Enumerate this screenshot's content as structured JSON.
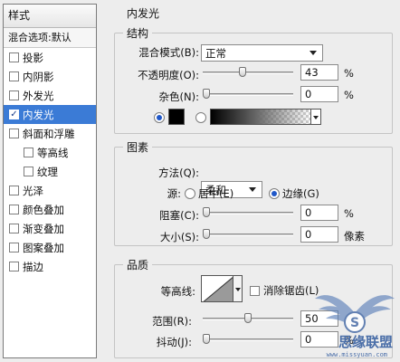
{
  "styles_panel": {
    "header": "样式",
    "blend_options": "混合选项:默认",
    "items": [
      {
        "label": "投影",
        "checked": false,
        "sub": false,
        "selected": false
      },
      {
        "label": "内阴影",
        "checked": false,
        "sub": false,
        "selected": false
      },
      {
        "label": "外发光",
        "checked": false,
        "sub": false,
        "selected": false
      },
      {
        "label": "内发光",
        "checked": true,
        "sub": false,
        "selected": true
      },
      {
        "label": "斜面和浮雕",
        "checked": false,
        "sub": false,
        "selected": false
      },
      {
        "label": "等高线",
        "checked": false,
        "sub": true,
        "selected": false
      },
      {
        "label": "纹理",
        "checked": false,
        "sub": true,
        "selected": false
      },
      {
        "label": "光泽",
        "checked": false,
        "sub": false,
        "selected": false
      },
      {
        "label": "颜色叠加",
        "checked": false,
        "sub": false,
        "selected": false
      },
      {
        "label": "渐变叠加",
        "checked": false,
        "sub": false,
        "selected": false
      },
      {
        "label": "图案叠加",
        "checked": false,
        "sub": false,
        "selected": false
      },
      {
        "label": "描边",
        "checked": false,
        "sub": false,
        "selected": false
      }
    ]
  },
  "inner_glow": {
    "title": "内发光",
    "structure": {
      "title": "结构",
      "blend_mode_label": "混合模式(B):",
      "blend_mode_value": "正常",
      "opacity_label": "不透明度(O):",
      "opacity_value": "43",
      "opacity_level": 0.43,
      "noise_label": "杂色(N):",
      "noise_value": "0",
      "noise_level": 0,
      "percent": "%",
      "color_radio_selected": true,
      "gradient_radio_selected": false
    },
    "elements": {
      "title": "图素",
      "technique_label": "方法(Q):",
      "technique_value": "柔和",
      "source_label": "源:",
      "source_center": "居中(E)",
      "source_edge": "边缘(G)",
      "source_selected": "edge",
      "choke_label": "阻塞(C):",
      "choke_value": "0",
      "choke_level": 0,
      "size_label": "大小(S):",
      "size_value": "0",
      "size_level": 0,
      "percent": "%",
      "pixels": "像素"
    },
    "quality": {
      "title": "品质",
      "contour_label": "等高线:",
      "antialias_label": "消除锯齿(L)",
      "antialias_checked": false,
      "range_label": "范围(R):",
      "range_value": "50",
      "range_level": 0.5,
      "jitter_label": "抖动(J):",
      "jitter_value": "0",
      "jitter_level": 0,
      "percent": "%"
    }
  },
  "watermark": {
    "text": "思缘联盟",
    "sub": "www.missyuan.com"
  }
}
